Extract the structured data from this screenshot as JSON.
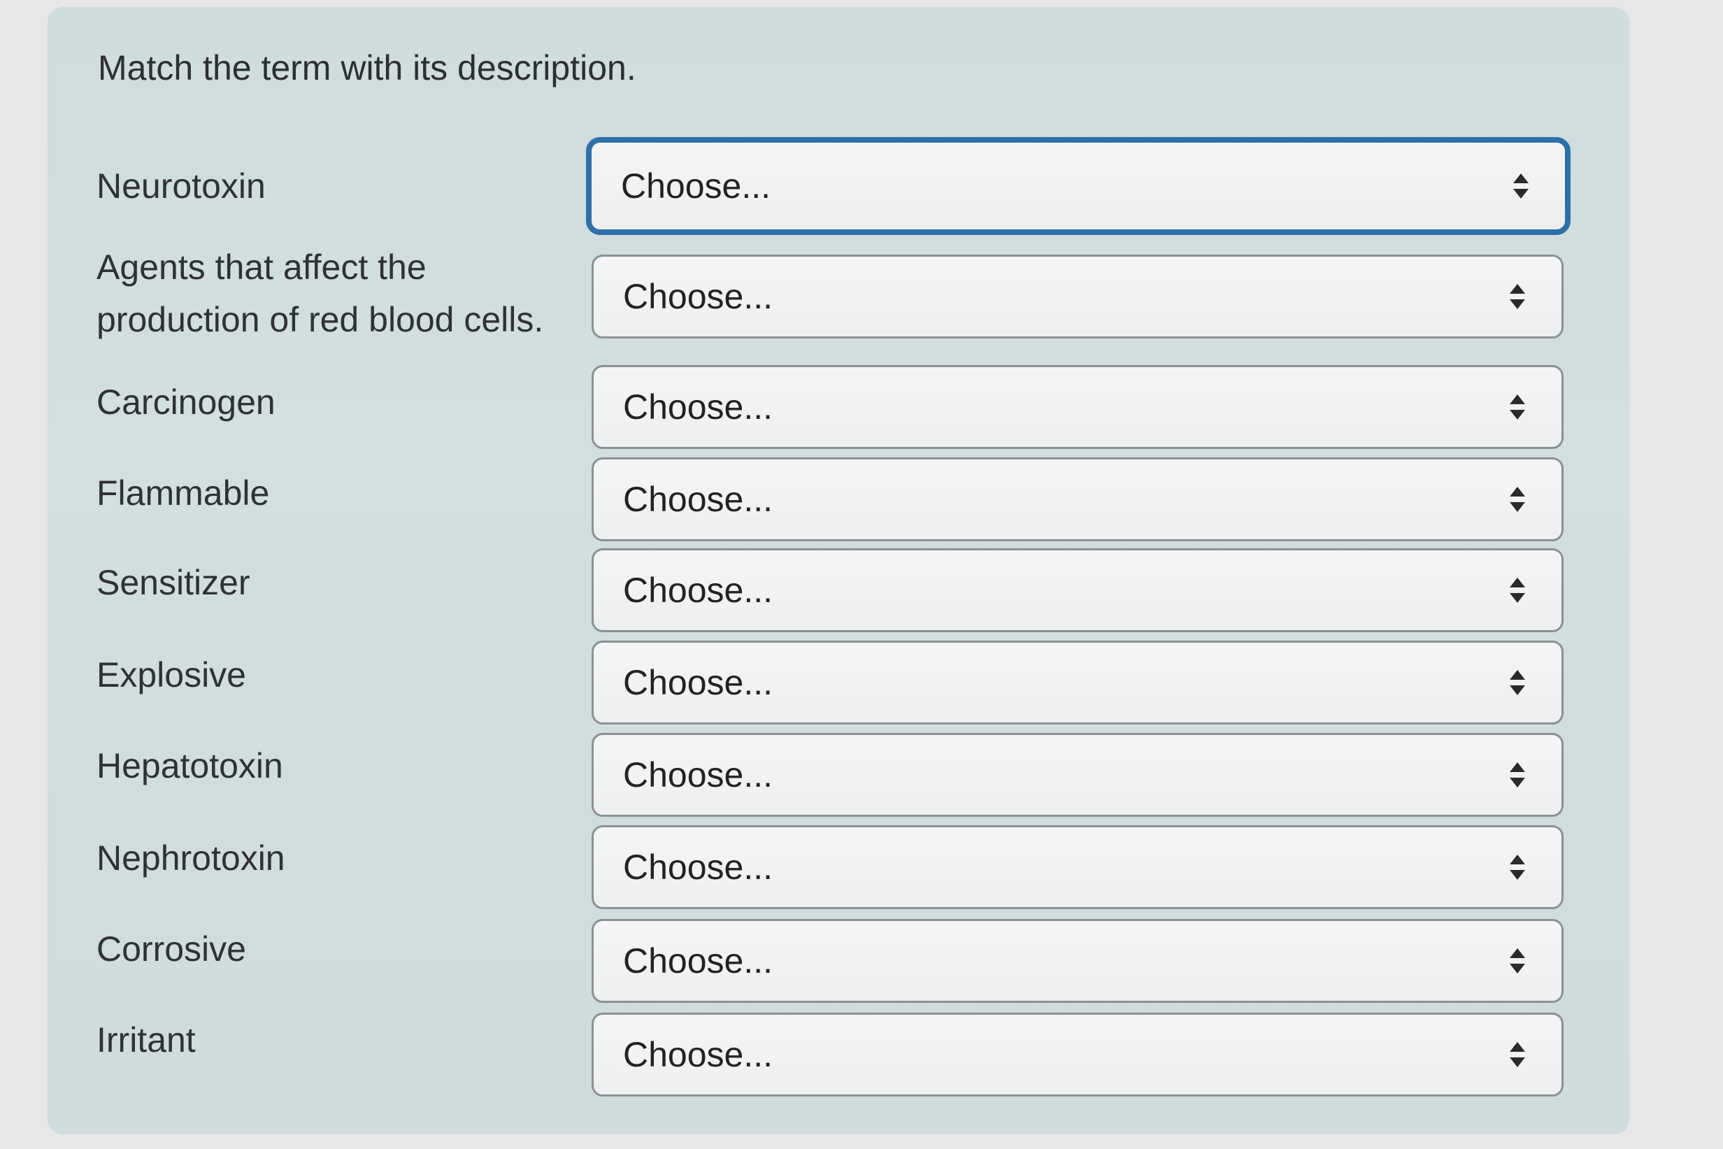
{
  "question": {
    "prompt": "Match the term with its description."
  },
  "rows": [
    {
      "term": "Neurotoxin",
      "select_value": "Choose..."
    },
    {
      "term_line1": "Agents that affect the",
      "term_line2": "production of red blood cells.",
      "select_value": "Choose..."
    },
    {
      "term": "Carcinogen",
      "select_value": "Choose..."
    },
    {
      "term": "Flammable",
      "select_value": "Choose..."
    },
    {
      "term": "Sensitizer",
      "select_value": "Choose..."
    },
    {
      "term": "Explosive",
      "select_value": "Choose..."
    },
    {
      "term": "Hepatotoxin",
      "select_value": "Choose..."
    },
    {
      "term": "Nephrotoxin",
      "select_value": "Choose..."
    },
    {
      "term": "Corrosive",
      "select_value": "Choose..."
    },
    {
      "term": "Irritant",
      "select_value": "Choose..."
    }
  ],
  "icons": {
    "select_caret": "up-down-chevron-icon"
  },
  "colors": {
    "focus_border": "#2f6fa8",
    "panel_bg": "#d0dcdd",
    "select_bg": "#f2f3f3"
  }
}
